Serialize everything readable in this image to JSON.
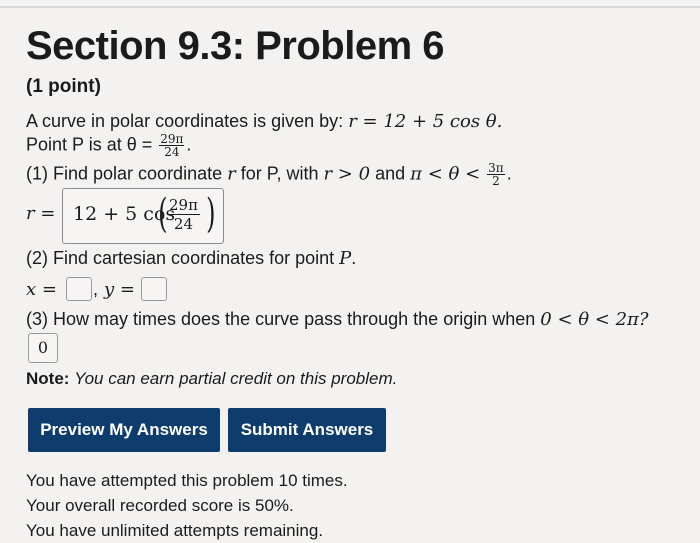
{
  "problem": {
    "title": "Section 9.3: Problem 6",
    "points": "(1 point)",
    "intro": "A curve in polar coordinates is given by:",
    "equation": "r = 12 + 5 cos θ.",
    "point_text": "Point P is at θ =",
    "point_num": "29π",
    "point_den": "24",
    "part1_label": "(1) Find polar coordinate",
    "part1_mid": "for P, with",
    "part1_cond": "r > 0",
    "part1_and": "and",
    "part1_range": "π < θ <",
    "part1_range_num": "3π",
    "part1_range_den": "2",
    "part1_answer_lhs": "r =",
    "part1_answer_value": "12 + 5 cos",
    "part1_answer_num": "29π",
    "part1_answer_den": "24",
    "part2_label": "(2) Find cartesian coordinates for point",
    "part2_x": "x =",
    "part2_y": "y =",
    "part3_label": "(3) How may times does the curve pass through the origin when",
    "part3_range": "0 < θ < 2π?",
    "part3_answer": "0",
    "note_label": "Note:",
    "note_text": "You can earn partial credit on this problem."
  },
  "buttons": {
    "preview": "Preview My Answers",
    "submit": "Submit Answers"
  },
  "status": {
    "attempts": "You have attempted this problem 10 times.",
    "score": "Your overall recorded score is 50%.",
    "remaining": "You have unlimited attempts remaining."
  },
  "colors": {
    "button_bg": "#0e3d6d",
    "page_bg": "#f3f2f0"
  }
}
